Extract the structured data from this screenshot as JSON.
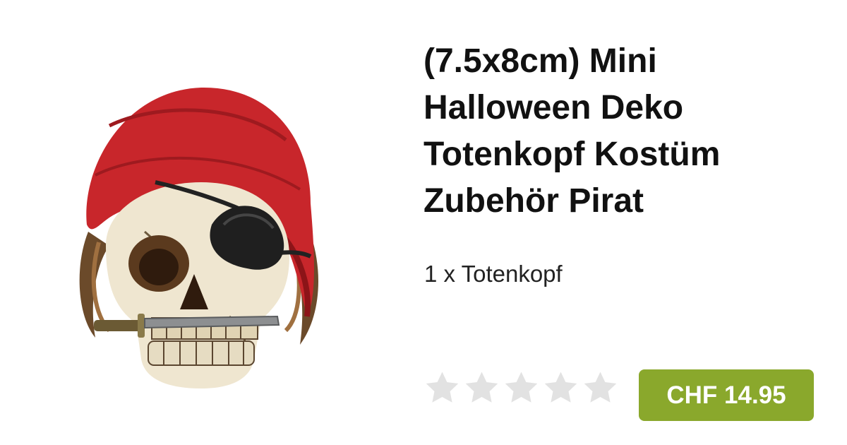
{
  "product": {
    "title": "(7.5x8cm) Mini Halloween Deko Totenkopf Kostüm Zubehör Pirat",
    "subtitle": "1 x Totenkopf",
    "price": "CHF 14.95",
    "rating": {
      "filled": 0,
      "max": 5
    },
    "image": "pirate-skull-figurine"
  },
  "colors": {
    "price_badge": "#8aa82c",
    "star_empty": "#e2e2e2",
    "bandana": "#c8262b"
  }
}
